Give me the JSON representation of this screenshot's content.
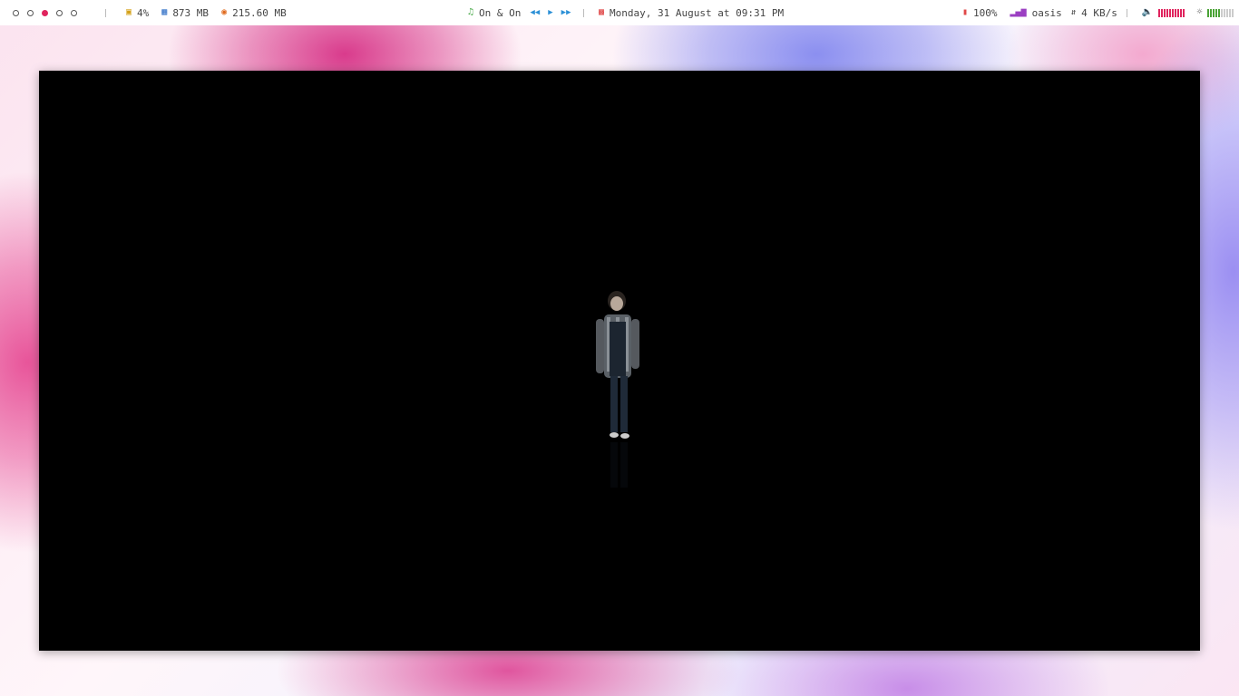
{
  "workspaces": [
    {
      "active": false
    },
    {
      "active": false
    },
    {
      "active": true
    },
    {
      "active": false
    },
    {
      "active": false
    }
  ],
  "stats": {
    "cpu": "4%",
    "ram": "873 MB",
    "disk": "215.60 MB"
  },
  "media": {
    "track": "On & On",
    "prev_icon": "rewind-icon",
    "play_icon": "play-icon",
    "next_icon": "fast-forward-icon"
  },
  "clock": {
    "datetime": "Monday, 31 August at 09:31 PM"
  },
  "system": {
    "battery": "100%",
    "network_name": "oasis",
    "network_speed": "4 KB/s",
    "volume_level": 1.0,
    "brightness_level": 0.5
  },
  "colors": {
    "active_workspace": "#e0245e",
    "cpu_icon": "#d4a017",
    "ram_icon": "#2f6fc6",
    "disk_icon": "#e06b1f",
    "music_icon": "#3aa33a",
    "media_controls": "#2a8fd6",
    "calendar_icon": "#e04848",
    "battery_icon": "#e04848",
    "network_icon": "#9b3fc2",
    "volume_bars": "#e0245e",
    "brightness_bars": "#4aa336"
  }
}
